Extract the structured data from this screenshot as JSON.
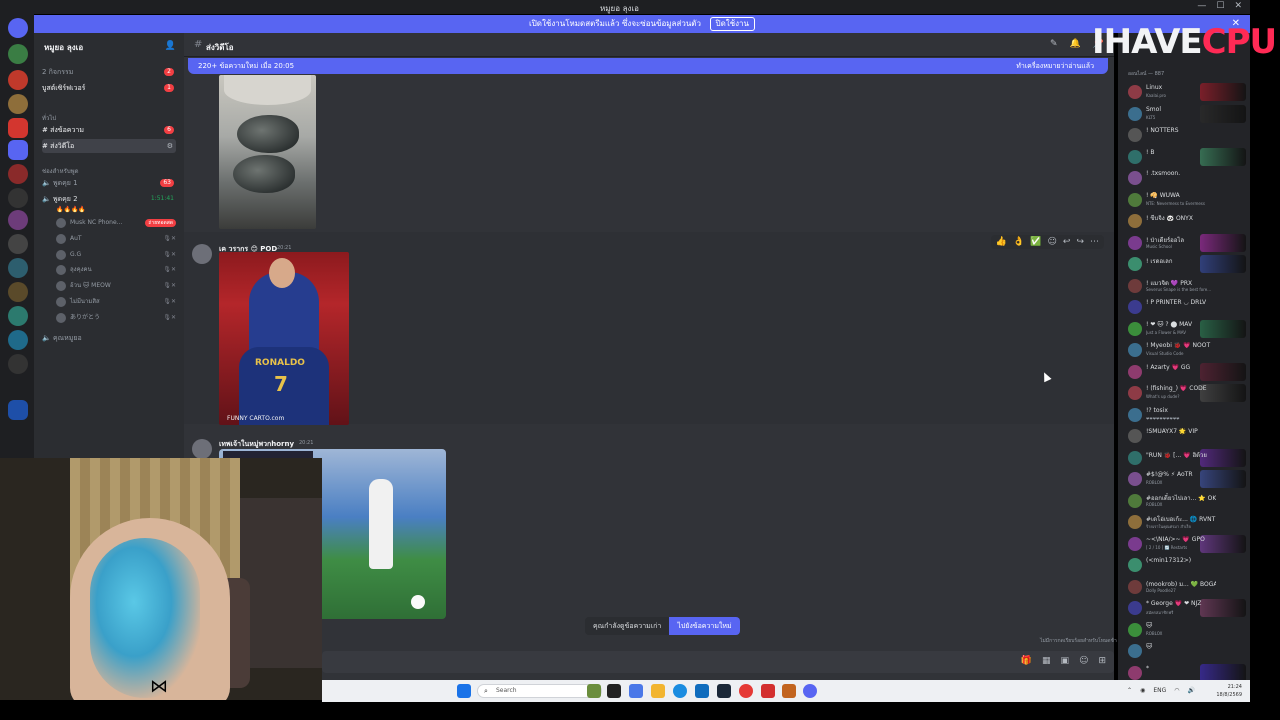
{
  "window": {
    "title": "หมูยอ ลุงเอ",
    "controls": [
      "—",
      "☐",
      "✕"
    ]
  },
  "banner": {
    "text": "เปิดใช้งานโหมดสตรีมแล้ว ซึ่งจะซ่อนข้อมูลส่วนตัว",
    "button": "ปิดใช้งาน",
    "close": "✕"
  },
  "sidebar": {
    "server_name": "หมูยอ ลุงเอ",
    "top_rows": [
      {
        "label": "2 กิจกรรม",
        "count": "2"
      },
      {
        "label": "บูสต์เซิร์ฟเวอร์",
        "count": "1"
      }
    ],
    "category_general": "ทั่วไป",
    "channels": [
      {
        "label": "ส่งข้อความ",
        "count": "6"
      },
      {
        "label": "ส่งวิดีโอ",
        "count": ""
      }
    ],
    "category_voice": "ช่องสำหรับพูด",
    "voice_channels": [
      {
        "label": "พูดคุย 1",
        "count": "63"
      },
      {
        "label": "พูดคุย 2",
        "time": "1:51:41"
      }
    ],
    "voice_emoji": "🔥🔥🔥🔥",
    "voice_users": [
      {
        "name": "Musk NC Phone...",
        "badge": "ถ่ายทอดสด"
      },
      {
        "name": "AuT"
      },
      {
        "name": "G.G"
      },
      {
        "name": "ลุงคุงคน"
      },
      {
        "name": "อ้วน 🐱 MEOW"
      },
      {
        "name": "ไม่มีนามสิส"
      },
      {
        "name": "ありがとう"
      }
    ],
    "bottom_channel": "คุณหมูยอ"
  },
  "chat": {
    "channel_name": "ส่งวิดีโอ",
    "new_messages_left": "220+ ข้อความใหม่ เมื่อ 20:05",
    "new_messages_right": "ทำเครื่องหมายว่าอ่านแล้ว",
    "messages": [
      {
        "author": "เค วรากร 😊 POD",
        "time": "20:21"
      },
      {
        "author": "เทพเจ้าในหมู่พวกhorny",
        "time": "20:21"
      }
    ],
    "image_caption_number": "7",
    "image_caption_name": "RONALDO",
    "image_watermark": "FUNNY CARTO.com",
    "hover_actions": [
      "👍",
      "👌",
      "✅",
      "☺",
      "↩",
      "↪",
      "⋯"
    ],
    "jump_older": "คุณกำลังดูข้อความเก่า",
    "jump_newer": "ไปยังข้อความใหม่",
    "slowmode_text": "ไม่มีการกดเรียบร้อยสำหรับโหมดช้า"
  },
  "right_panel": {
    "header": "ออนไลน์ — 887",
    "logo_text_1": "IHAVE",
    "logo_text_2": "CPU",
    "members": [
      {
        "name": "Linux",
        "sub": "Kaalai.pro"
      },
      {
        "name": "Smol",
        "sub": "KLT5"
      },
      {
        "name": "! NOTTERS",
        "sub": ""
      },
      {
        "name": "! B",
        "sub": ""
      },
      {
        "name": "! .txsmoon.",
        "sub": ""
      },
      {
        "name": "! 🥠 WUWA",
        "sub": "NTE: Nevermess to Evermess"
      },
      {
        "name": "! ขีบจิง 🐼 ONYX",
        "sub": ""
      },
      {
        "name": "! ป่าเดียร์ออไล",
        "sub": "Music School"
      },
      {
        "name": "! เรดอเลก",
        "sub": ""
      },
      {
        "name": "! แมวจิด 💜 PRX",
        "sub": "Severus Snape is the best fore..."
      },
      {
        "name": "! P PRINTER ◡ DRLV",
        "sub": ""
      },
      {
        "name": "! ❤ 🐱 ? ⬤ MAV",
        "sub": "Just a Flower & MAV"
      },
      {
        "name": "! Myeobi 🐞 💗 NOOT",
        "sub": "Visual Studio Code"
      },
      {
        "name": "! Azarty 💗 GG",
        "sub": ""
      },
      {
        "name": "! (fishing_) 💗 CODE",
        "sub": "What's up dude?"
      },
      {
        "name": "!? tosix",
        "sub": "❤❤❤❤❤❤❤❤❤❤"
      },
      {
        "name": "!SMUAYX7 🌟 VIP",
        "sub": ""
      },
      {
        "name": "\"RUN 🐞 [... 💗 ฮิด้วย",
        "sub": ""
      },
      {
        "name": "#$!@% ⚡ AoTR",
        "sub": "ROBLOX"
      },
      {
        "name": "#ออกเดี๋ยวไปเลา...  ⭐ OKRN",
        "sub": "ROBLOX"
      },
      {
        "name": "#เดโอ่เบอเก้ะ... 🌐 RVNT",
        "sub": "ร้ายเราในคุณศรมา สำเร็จ"
      },
      {
        "name": "~<\\NIA/>~ 💗 GPO",
        "sub": "[ 2 / 10 ] 🔄 Restarts"
      },
      {
        "name": "(<min17312>)",
        "sub": ""
      },
      {
        "name": "(mookrob) ม... 💚 BOGA",
        "sub": "Dolly Poodle27"
      },
      {
        "name": "* George 💗 ❤ NJZ",
        "sub": "สมัครสมาชิกฟรี"
      },
      {
        "name": "🐱",
        "sub": "ROBLOX"
      },
      {
        "name": "🐱",
        "sub": ""
      },
      {
        "name": "*",
        "sub": ""
      }
    ]
  },
  "taskbar": {
    "search_placeholder": "Search",
    "time": "21:24",
    "date": "18/8/2569",
    "lang": "ENG"
  },
  "colors": {
    "accent": "#5865f2",
    "sidebar_bg": "#2b2d31",
    "chat_bg": "#313338",
    "rail_bg": "#1e1f22",
    "danger": "#f23f43"
  }
}
